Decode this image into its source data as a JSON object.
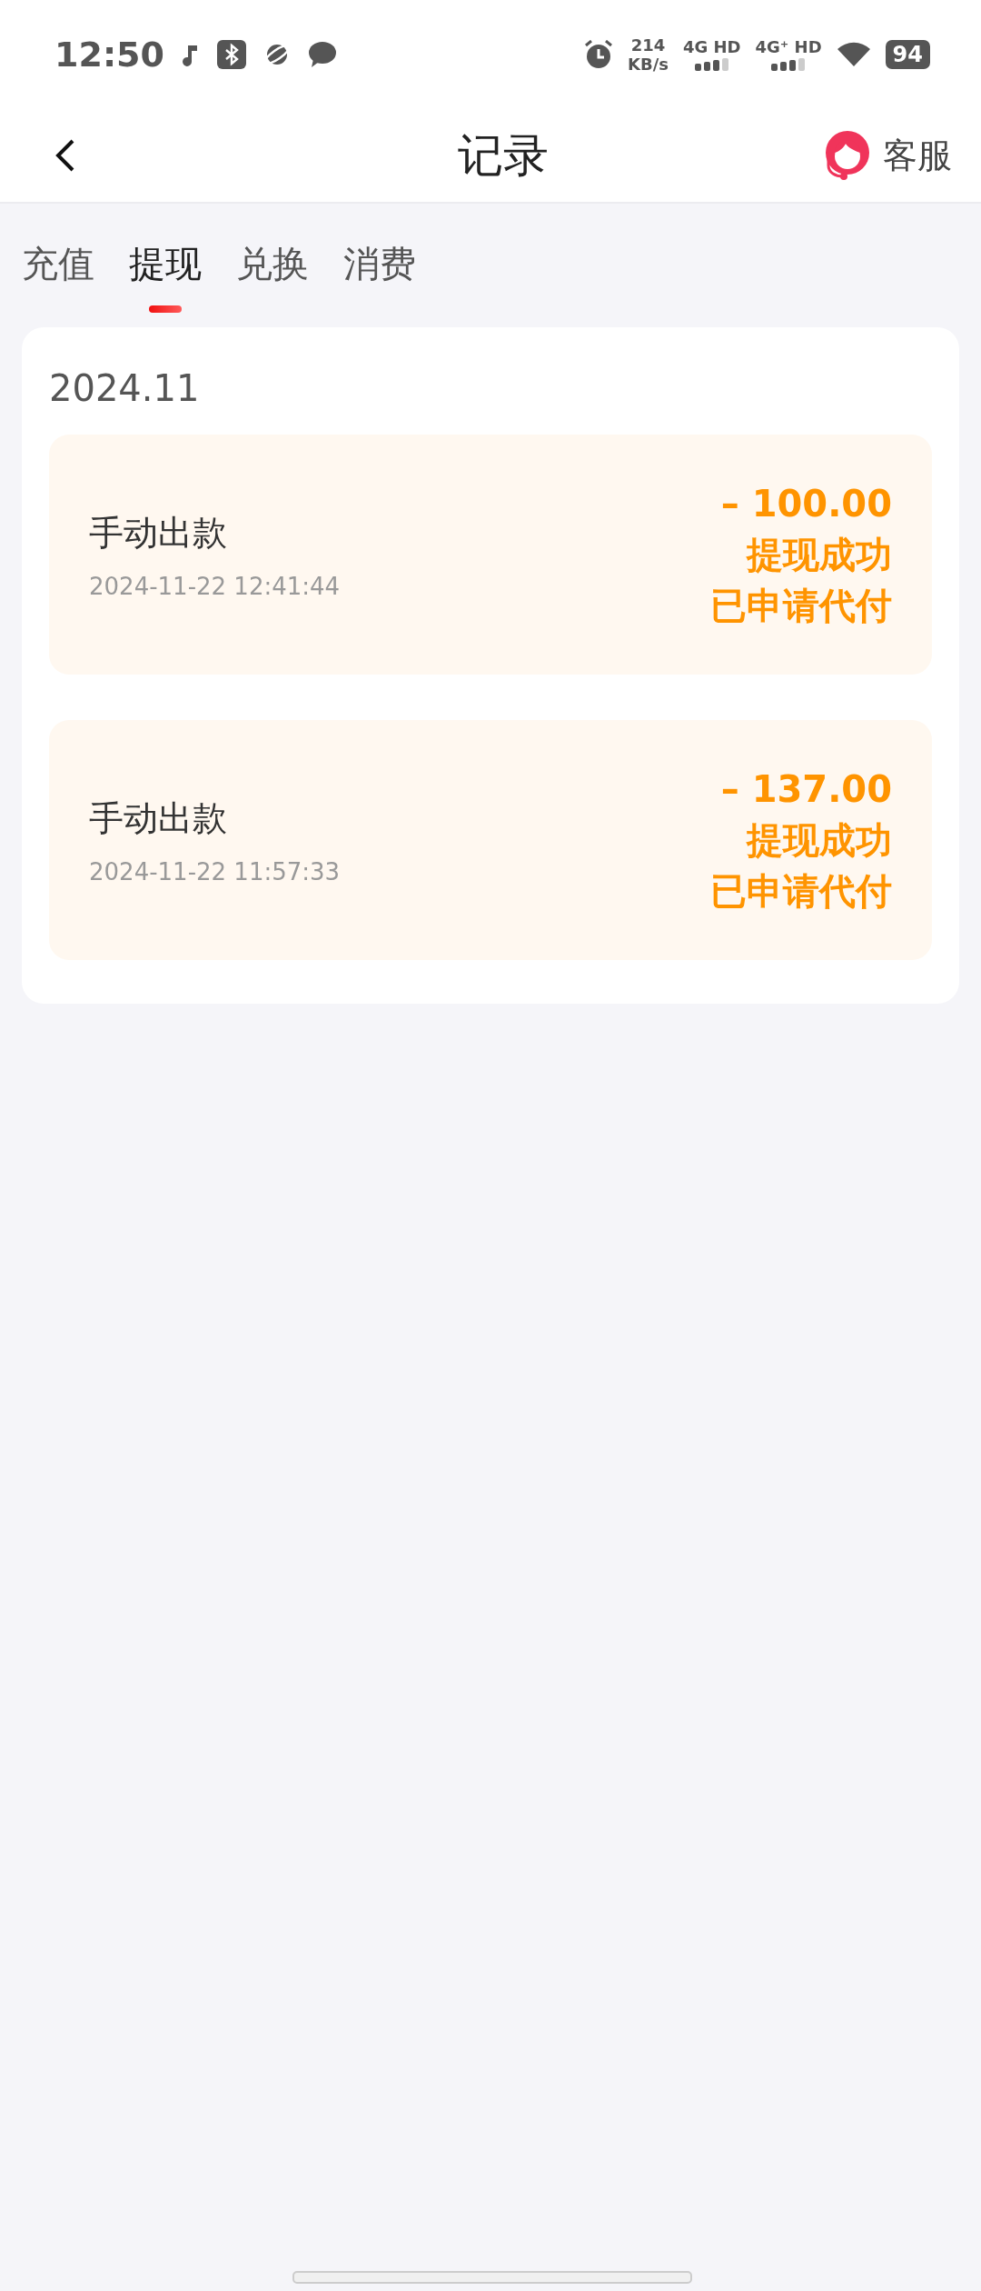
{
  "status_bar": {
    "time": "12:50",
    "speed": "214",
    "speed_unit": "KB/s",
    "sim1": "4G HD",
    "sim2": "4G⁺ HD",
    "battery": "94"
  },
  "header": {
    "title": "记录",
    "service": "客服"
  },
  "tabs": [
    {
      "label": "充值",
      "selected": false
    },
    {
      "label": "提现",
      "selected": true
    },
    {
      "label": "兑换",
      "selected": false
    },
    {
      "label": "消费",
      "selected": false
    }
  ],
  "month": "2024.11",
  "records": [
    {
      "title": "手动出款",
      "time": "2024-11-22 12:41:44",
      "amount": "– 100.00",
      "status": "提现成功",
      "note": "已申请代付"
    },
    {
      "title": "手动出款",
      "time": "2024-11-22 11:57:33",
      "amount": "– 137.00",
      "status": "提现成功",
      "note": "已申请代付"
    }
  ]
}
